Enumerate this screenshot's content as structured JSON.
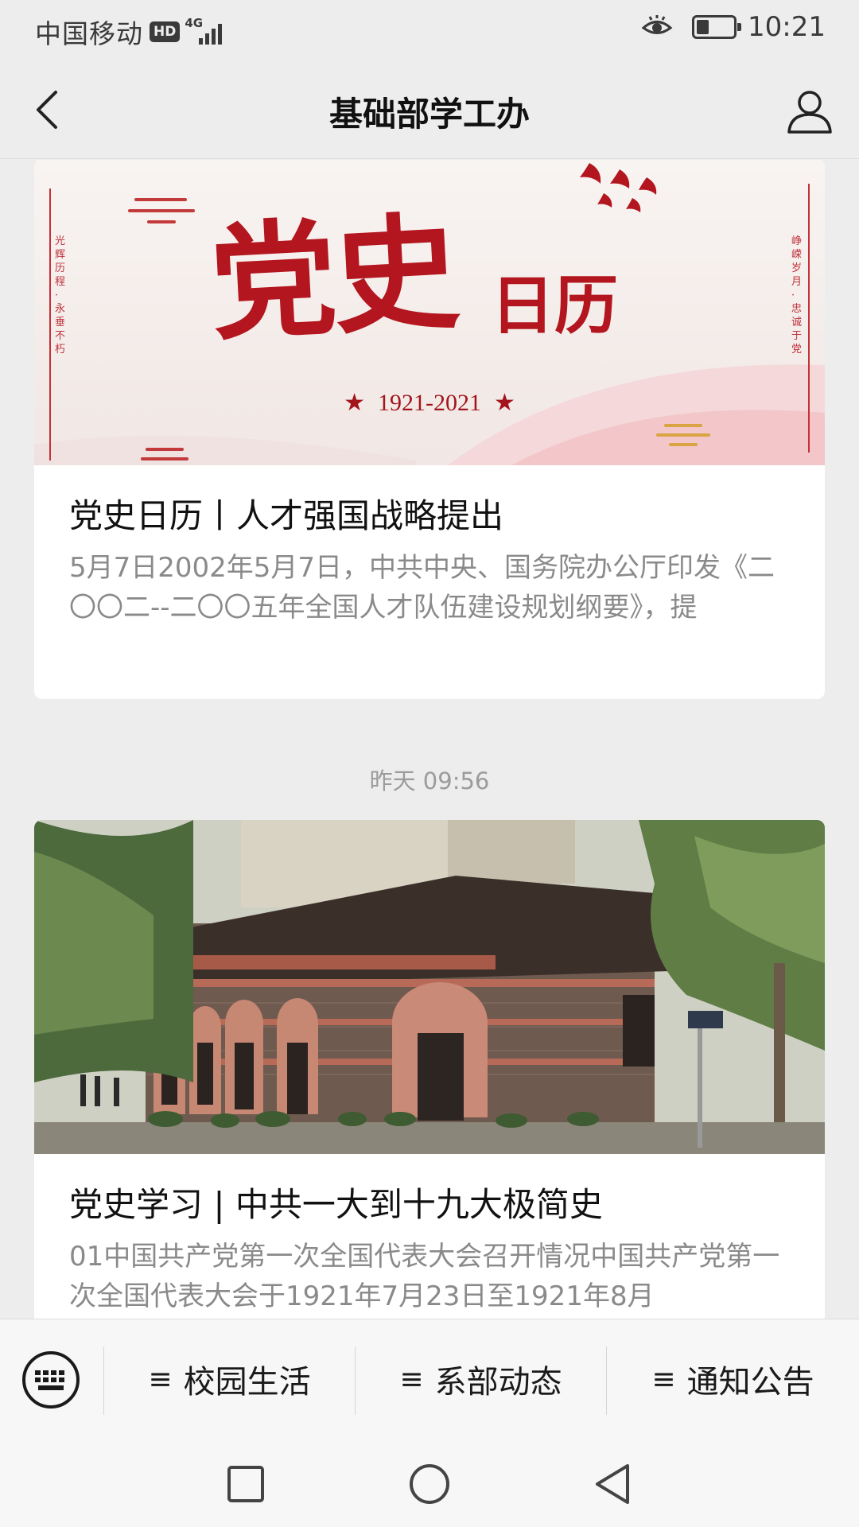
{
  "status_bar": {
    "carrier": "中国移动",
    "hd_badge": "HD",
    "network_type": "4G",
    "time": "10:21",
    "battery_level": 0.35
  },
  "nav": {
    "title": "基础部学工办",
    "back_icon": "chevron-left-icon",
    "profile_icon": "person-icon"
  },
  "articles": [
    {
      "cover": {
        "big_chars": "党史",
        "small_chars": "日历",
        "years": "1921-2021",
        "left_vertical": "光辉历程·永垂不朽",
        "right_vertical": "峥嵘岁月·忠诚于党"
      },
      "title": "党史日历丨人才强国战略提出",
      "summary": "5月7日2002年5月7日，中共中央、国务院办公厅印发《二〇〇二--二〇〇五年全国人才队伍建设规划纲要》，提"
    },
    {
      "title": "党史学习 | 中共一大到十九大极简史",
      "summary": "01中国共产党第一次全国代表大会召开情况中国共产党第一次全国代表大会于1921年7月23日至1921年8月"
    }
  ],
  "timestamp": "昨天 09:56",
  "bottom_menu": {
    "keyboard_icon": "keyboard-icon",
    "menu_glyph": "≡",
    "items": [
      "校园生活",
      "系部动态",
      "通知公告"
    ]
  },
  "system_nav": [
    "square-icon",
    "circle-icon",
    "triangle-back-icon"
  ],
  "colors": {
    "background": "#ededed",
    "party_red": "#b3161e",
    "text_primary": "#111111",
    "text_secondary": "#8a8a8a"
  }
}
